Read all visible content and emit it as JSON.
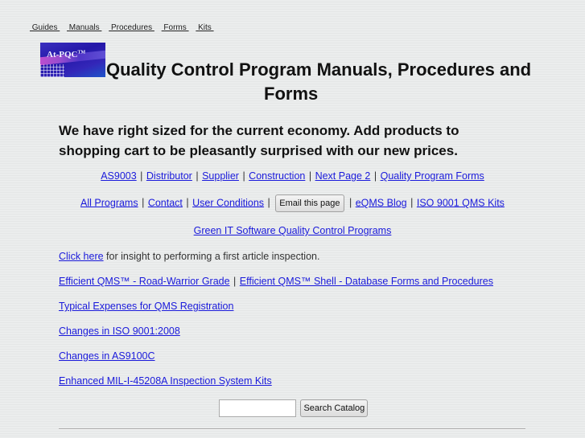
{
  "top_nav": [
    {
      "label": " Guides "
    },
    {
      "label": " Manuals "
    },
    {
      "label": " Procedures "
    },
    {
      "label": " Forms "
    },
    {
      "label": " Kits "
    }
  ],
  "logo": {
    "text": "At-PQC",
    "tm": "TM"
  },
  "header": {
    "title_line1": "Quality Control Program Manuals, Procedures and",
    "title_line2": "Forms"
  },
  "promo": "We have right sized for the current economy. Add products to shopping cart to be pleasantly surprised with our new prices.",
  "link_row_1": [
    {
      "label": "AS9003"
    },
    {
      "label": "Distributor"
    },
    {
      "label": "Supplier"
    },
    {
      "label": "Construction"
    },
    {
      "label": "Next Page 2"
    },
    {
      "label": "Quality Program Forms"
    }
  ],
  "link_row_2": {
    "links_before": [
      {
        "label": "All Programs"
      },
      {
        "label": "Contact"
      },
      {
        "label": "User Conditions"
      }
    ],
    "email_button": "Email this page",
    "links_after": [
      {
        "label": "eQMS Blog"
      },
      {
        "label": "ISO 9001 QMS Kits"
      }
    ]
  },
  "separator": "|",
  "green_link": "Green IT Software Quality Control Programs",
  "first_article": {
    "link": "Click here",
    "text": " for insight to performing a first article inspection."
  },
  "efficient_links": [
    {
      "label": "Efficient QMS™ - Road-Warrior Grade"
    },
    {
      "label": "Efficient QMS™ Shell - Database Forms and Procedures"
    }
  ],
  "links": [
    {
      "label": "Typical Expenses for QMS Registration"
    },
    {
      "label": "Changes in ISO 9001:2008"
    },
    {
      "label": "Changes in AS9100C"
    },
    {
      "label": "Enhanced MIL-I-45208A Inspection System Kits"
    }
  ],
  "search": {
    "value": "",
    "button_label": "Search Catalog"
  }
}
